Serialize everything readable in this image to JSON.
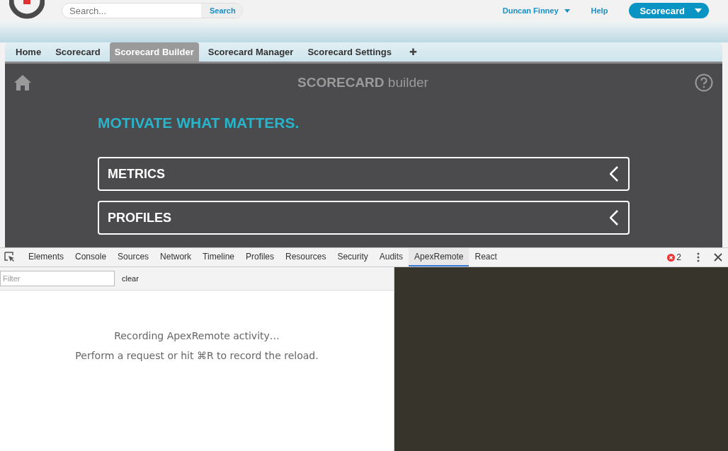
{
  "header": {
    "search": {
      "placeholder": "Search...",
      "button": "Search"
    },
    "user": "Duncan Finney",
    "help": "Help",
    "app_button": "Scorecard"
  },
  "tabs": [
    {
      "label": "Home",
      "selected": false
    },
    {
      "label": "Scorecard",
      "selected": false
    },
    {
      "label": "Scorecard Builder",
      "selected": true
    },
    {
      "label": "Scorecard Manager",
      "selected": false
    },
    {
      "label": "Scorecard Settings",
      "selected": false
    }
  ],
  "add_tab": "✚",
  "builder": {
    "title_bold": "SCORECARD",
    "title_light": "builder",
    "tagline": "MOTIVATE WHAT MATTERS.",
    "sections": [
      {
        "label": "METRICS",
        "expanded": false
      },
      {
        "label": "PROFILES",
        "expanded": false
      }
    ]
  },
  "devtools": {
    "tabs": [
      {
        "label": "Elements",
        "selected": false
      },
      {
        "label": "Console",
        "selected": false
      },
      {
        "label": "Sources",
        "selected": false
      },
      {
        "label": "Network",
        "selected": false
      },
      {
        "label": "Timeline",
        "selected": false
      },
      {
        "label": "Profiles",
        "selected": false
      },
      {
        "label": "Resources",
        "selected": false
      },
      {
        "label": "Security",
        "selected": false
      },
      {
        "label": "Audits",
        "selected": false
      },
      {
        "label": "ApexRemote",
        "selected": true
      },
      {
        "label": "React",
        "selected": false
      }
    ],
    "error_count": "2",
    "filter": {
      "placeholder": "Filter"
    },
    "clear": "clear",
    "messages": [
      "Recording ApexRemote activity…",
      "Perform a request or hit ⌘R to record the reload."
    ]
  }
}
